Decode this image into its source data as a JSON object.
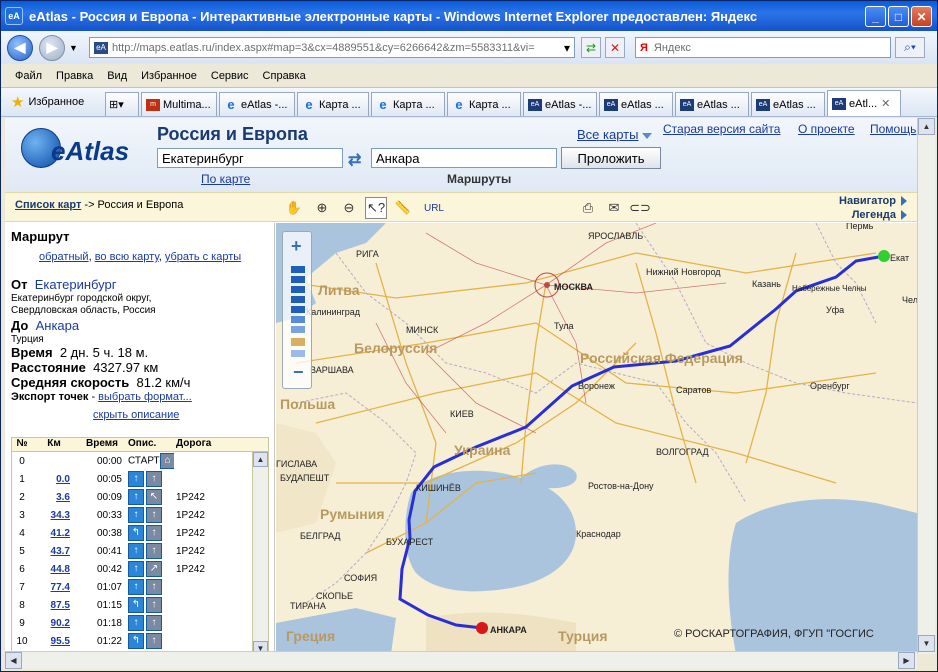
{
  "window": {
    "title": "eAtlas - Россия и Европа - Интерактивные электронные карты - Windows Internet Explorer предоставлен: Яндекс",
    "minimize": "_",
    "maximize": "□",
    "close": "✕"
  },
  "browser": {
    "url": "http://maps.eatlas.ru/index.aspx#map=3&cx=4889551&cy=6266642&zm=5583311&vi=",
    "search_placeholder": "Яндекс",
    "search_logo": "Я",
    "menu": [
      "Файл",
      "Правка",
      "Вид",
      "Избранное",
      "Сервис",
      "Справка"
    ],
    "favorites_label": "Избранное",
    "tabs": [
      "Multima...",
      "eAtlas -...",
      "Карта ...",
      "Карта ...",
      "Карта ...",
      "eAtlas -...",
      "eAtlas ...",
      "eAtlas ...",
      "eAtlas ...",
      "eAtl..."
    ],
    "active_tab_index": 9
  },
  "site": {
    "logo_text": "eAtlas",
    "title": "Россия и Европа",
    "from_value": "Екатеринбург",
    "to_value": "Анкара",
    "go_button": "Проложить",
    "by_map": "По карте",
    "routes": "Маршруты",
    "all_maps": "Все карты",
    "old_version": "Старая версия сайта",
    "about": "О проекте",
    "help": "Помощь"
  },
  "toolbar": {
    "breadcrumb_link": "Список карт",
    "breadcrumb_rest": "-> Россия и Европа",
    "url_label": "URL",
    "navigator": "Навигатор",
    "legend": "Легенда"
  },
  "route": {
    "heading": "Маршрут",
    "reverse": "обратный",
    "whole_map": "во всю карту",
    "remove": "убрать с карты",
    "from_label": "От",
    "from_city": "Екатеринбург",
    "from_desc1": "Екатеринбург городской округ,",
    "from_desc2": "Свердловская область, Россия",
    "to_label": "До",
    "to_city": "Анкара",
    "to_desc": "Турция",
    "time_label": "Время",
    "time_value": "2 дн. 5 ч. 18 м.",
    "distance_label": "Расстояние",
    "distance_value": "4327.97 км",
    "speed_label": "Средняя скорость",
    "speed_value": "81.2 км/ч",
    "export_label": "Экспорт точек",
    "export_link": "выбрать формат...",
    "hide_desc": "скрыть описание",
    "columns": [
      "№",
      "Км",
      "Время",
      "Опис.",
      "Дорога"
    ],
    "rows": [
      {
        "n": "0",
        "km": "",
        "time": "00:00",
        "desc": "СТАРТ",
        "road": ""
      },
      {
        "n": "1",
        "km": "0.0",
        "time": "00:05",
        "desc": "",
        "road": ""
      },
      {
        "n": "2",
        "km": "3.6",
        "time": "00:09",
        "desc": "",
        "road": "1Р242"
      },
      {
        "n": "3",
        "km": "34.3",
        "time": "00:33",
        "desc": "",
        "road": "1Р242"
      },
      {
        "n": "4",
        "km": "41.2",
        "time": "00:38",
        "desc": "",
        "road": "1Р242"
      },
      {
        "n": "5",
        "km": "43.7",
        "time": "00:41",
        "desc": "",
        "road": "1Р242"
      },
      {
        "n": "6",
        "km": "44.8",
        "time": "00:42",
        "desc": "",
        "road": "1Р242"
      },
      {
        "n": "7",
        "km": "77.4",
        "time": "01:07",
        "desc": "",
        "road": ""
      },
      {
        "n": "8",
        "km": "87.5",
        "time": "01:15",
        "desc": "",
        "road": ""
      },
      {
        "n": "9",
        "km": "90.2",
        "time": "01:18",
        "desc": "",
        "road": ""
      },
      {
        "n": "10",
        "km": "95.5",
        "time": "01:22",
        "desc": "",
        "road": ""
      }
    ]
  },
  "map": {
    "copyright": "© РОСКАРТОГРАФИЯ, ФГУП \"ГОСГИС",
    "cities": {
      "yaroslavl": "ЯРОСЛАВЛЬ",
      "perm": "Пермь",
      "ekat": "Екат",
      "riga": "РИГА",
      "nnovgorod": "Нижний Новгород",
      "kazan": "Казань",
      "nabchelny": "Набережные Челны",
      "moscow": "МОСКВА",
      "kaliningrad": "Калининград",
      "minsk": "МИНСК",
      "tula": "Тула",
      "ufa": "Уфа",
      "chel": "Чел",
      "warsaw": "ВАРШАВА",
      "voronezh": "Воронеж",
      "saratov": "Саратов",
      "orenburg": "Оренбург",
      "kiev": "КИЕВ",
      "volgograd": "ВОЛГОГРАД",
      "bratislava": "ГИСЛАВА",
      "budapest": "БУДАПЕШТ",
      "chisinau": "КИШИНЁВ",
      "rostov": "Ростов-на-Дону",
      "bucharest": "БУХАРЕСТ",
      "krasnodar": "Краснодар",
      "belgrade": "БЕЛГРАД",
      "sofia": "СОФИЯ",
      "skopje": "СКОПЬЕ",
      "tirana": "ТИРАНА",
      "ankara": "АНКАРА"
    },
    "regions": {
      "litva": "Литва",
      "belarus": "Белоруссия",
      "russia": "Российская Федерация",
      "poland": "Польша",
      "ukraine": "Украина",
      "romania": "Румыния",
      "greece": "Греция",
      "turkey": "Турция"
    },
    "colors": {
      "route": "#2a2ed8",
      "start": "#30d030",
      "end": "#d81818",
      "land": "#f4ecd0",
      "water": "#aac4de"
    }
  }
}
